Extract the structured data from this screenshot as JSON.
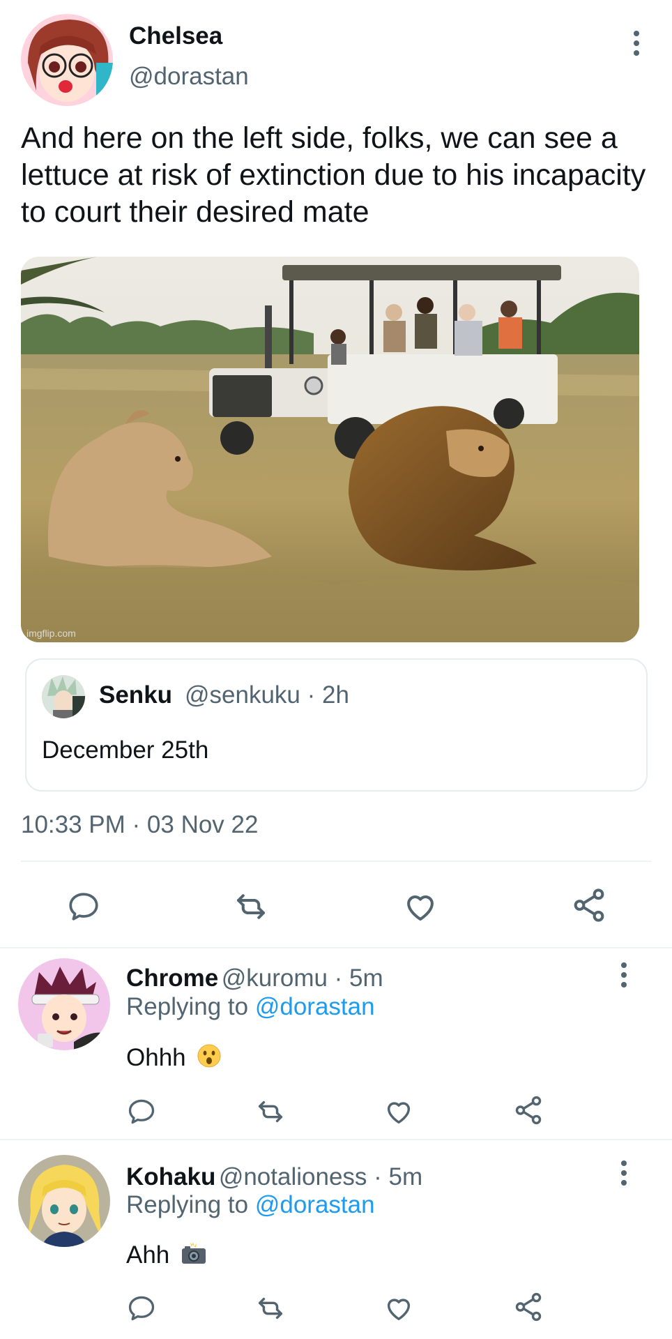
{
  "tweet": {
    "author_name": "Chelsea",
    "author_handle": "@dorastan",
    "text": "And here on the left side, folks, we can see a lettuce at risk of extinction due to his incapacity to court their desired mate",
    "image_watermark": "imgflip.com",
    "timestamp": "10:33 PM · 03 Nov 22"
  },
  "quoted_tweet": {
    "author_name": "Senku",
    "meta": "@senkuku · 2h",
    "text": "December 25th"
  },
  "actions": {
    "icons": [
      "reply-icon",
      "retweet-icon",
      "like-icon",
      "share-icon"
    ]
  },
  "replies": [
    {
      "author_name": "Chrome",
      "meta": "@kuromu · 5m",
      "replying_prefix": "Replying to ",
      "replying_mention": "@dorastan",
      "text": "Ohhh",
      "emoji": "astonished-face-icon"
    },
    {
      "author_name": "Kohaku",
      "meta": "@notalioness · 5m",
      "replying_prefix": "Replying to ",
      "replying_mention": "@dorastan",
      "text": "Ahh",
      "emoji": "camera-flash-icon"
    }
  ],
  "colors": {
    "primary_text": "#0f1419",
    "secondary_text": "#536471",
    "mention": "#1d9bf0",
    "border": "#e6ecf0"
  }
}
